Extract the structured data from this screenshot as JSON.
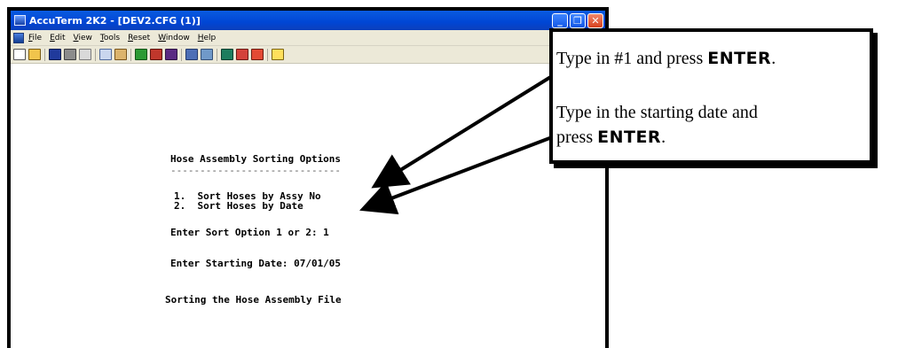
{
  "window": {
    "title": "AccuTerm 2K2 - [DEV2.CFG (1)]",
    "controls": {
      "minimize": "_",
      "maximize": "❐",
      "close": "✕"
    }
  },
  "menu": {
    "items": [
      "File",
      "Edit",
      "View",
      "Tools",
      "Reset",
      "Window",
      "Help"
    ]
  },
  "toolbar": {
    "icons": [
      "new-icon",
      "open-icon",
      "save-icon",
      "print-icon",
      "cut-icon",
      "copy-icon",
      "paste-icon",
      "connect-icon",
      "disconnect-icon",
      "capture-icon",
      "settings-icon",
      "keyboard-icon",
      "macro-icon",
      "script-icon",
      "transfer-icon",
      "help-icon"
    ]
  },
  "terminal": {
    "heading": "Hose Assembly Sorting Options",
    "divider": "-----------------------------",
    "option1": "1.  Sort Hoses by Assy No",
    "option2": "2.  Sort Hoses by Date",
    "prompt_option": "Enter Sort Option 1 or 2: 1",
    "prompt_date": "Enter Starting Date: 07/01/05",
    "status": "Sorting the Hose Assembly File"
  },
  "callout": {
    "line1_pre": "Type in #1 and press ",
    "line1_key": "ENTER",
    "line1_post": ".",
    "line2": "Type in the starting date and",
    "line3_pre": "press ",
    "line3_key": "ENTER",
    "line3_post": "."
  },
  "colors": {
    "titlebar": "#0046d5",
    "chrome": "#ece9d8",
    "close_button": "#d8411d"
  }
}
